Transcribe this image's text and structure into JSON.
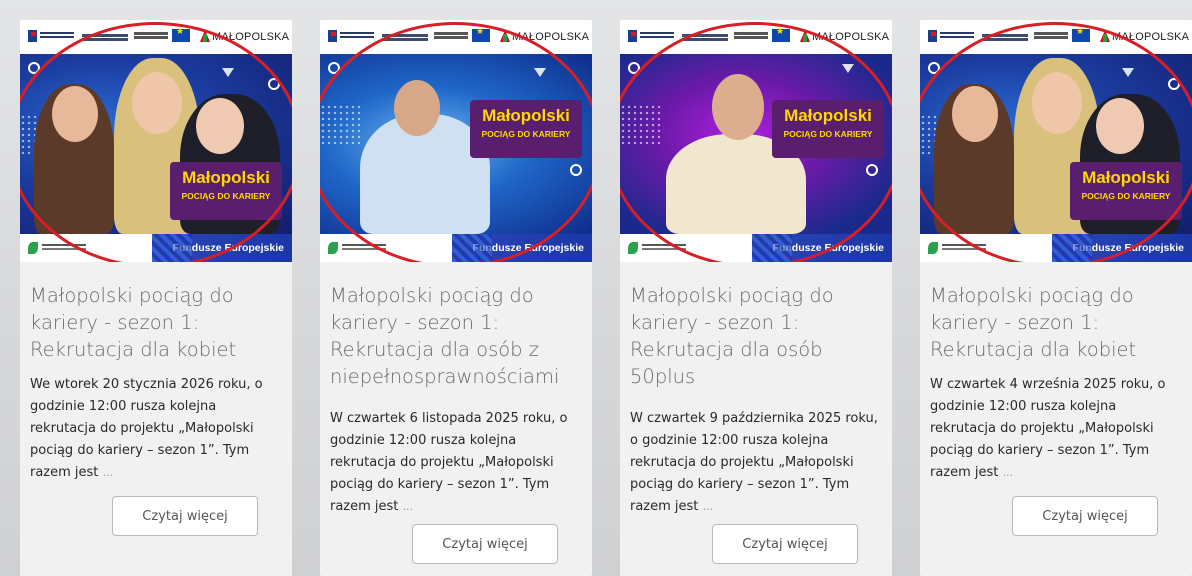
{
  "brand": {
    "region_logo_text": "MAŁOPOLSKA",
    "campaign_title": "Małopolski",
    "campaign_subtitle": "POCIĄG DO KARIERY",
    "funds_label": "Fundusze Europejskie"
  },
  "colors": {
    "oval_highlight": "#d61f26",
    "campaign_yellow": "#ffd800",
    "campaign_purple": "#5a1e6e",
    "banner_blue": "#1b3b9e"
  },
  "cards": [
    {
      "title": "Małopolski pociąg do kariery - sezon 1: Rekrutacja dla kobiet",
      "description": "We wtorek 20 stycznia 2026 roku, o godzinie 12:00 rusza kolejna rekrutacja do projektu „Małopolski pociąg do kariery – sezon 1”. Tym razem jest",
      "ellipsis": "...",
      "button_label": "Czytaj więcej"
    },
    {
      "title": "Małopolski pociąg do kariery - sezon 1: Rekrutacja dla osób z niepełnosprawnościami",
      "description": "W czwartek 6 listopada 2025 roku, o godzinie 12:00 rusza kolejna rekrutacja do projektu „Małopolski pociąg do kariery – sezon 1”. Tym razem jest",
      "ellipsis": "...",
      "button_label": "Czytaj więcej"
    },
    {
      "title": "Małopolski pociąg do kariery - sezon 1: Rekrutacja dla osób 50plus",
      "description": "W czwartek 9 października 2025 roku, o godzinie 12:00 rusza kolejna rekrutacja do projektu „Małopolski pociąg do kariery – sezon 1”. Tym razem jest",
      "ellipsis": "...",
      "button_label": "Czytaj więcej"
    },
    {
      "title": "Małopolski pociąg do kariery - sezon 1: Rekrutacja dla kobiet",
      "description": "W czwartek 4 września 2025 roku, o godzinie 12:00 rusza kolejna rekrutacja do projektu „Małopolski pociąg do kariery – sezon 1”. Tym razem jest",
      "ellipsis": "...",
      "button_label": "Czytaj więcej"
    }
  ]
}
